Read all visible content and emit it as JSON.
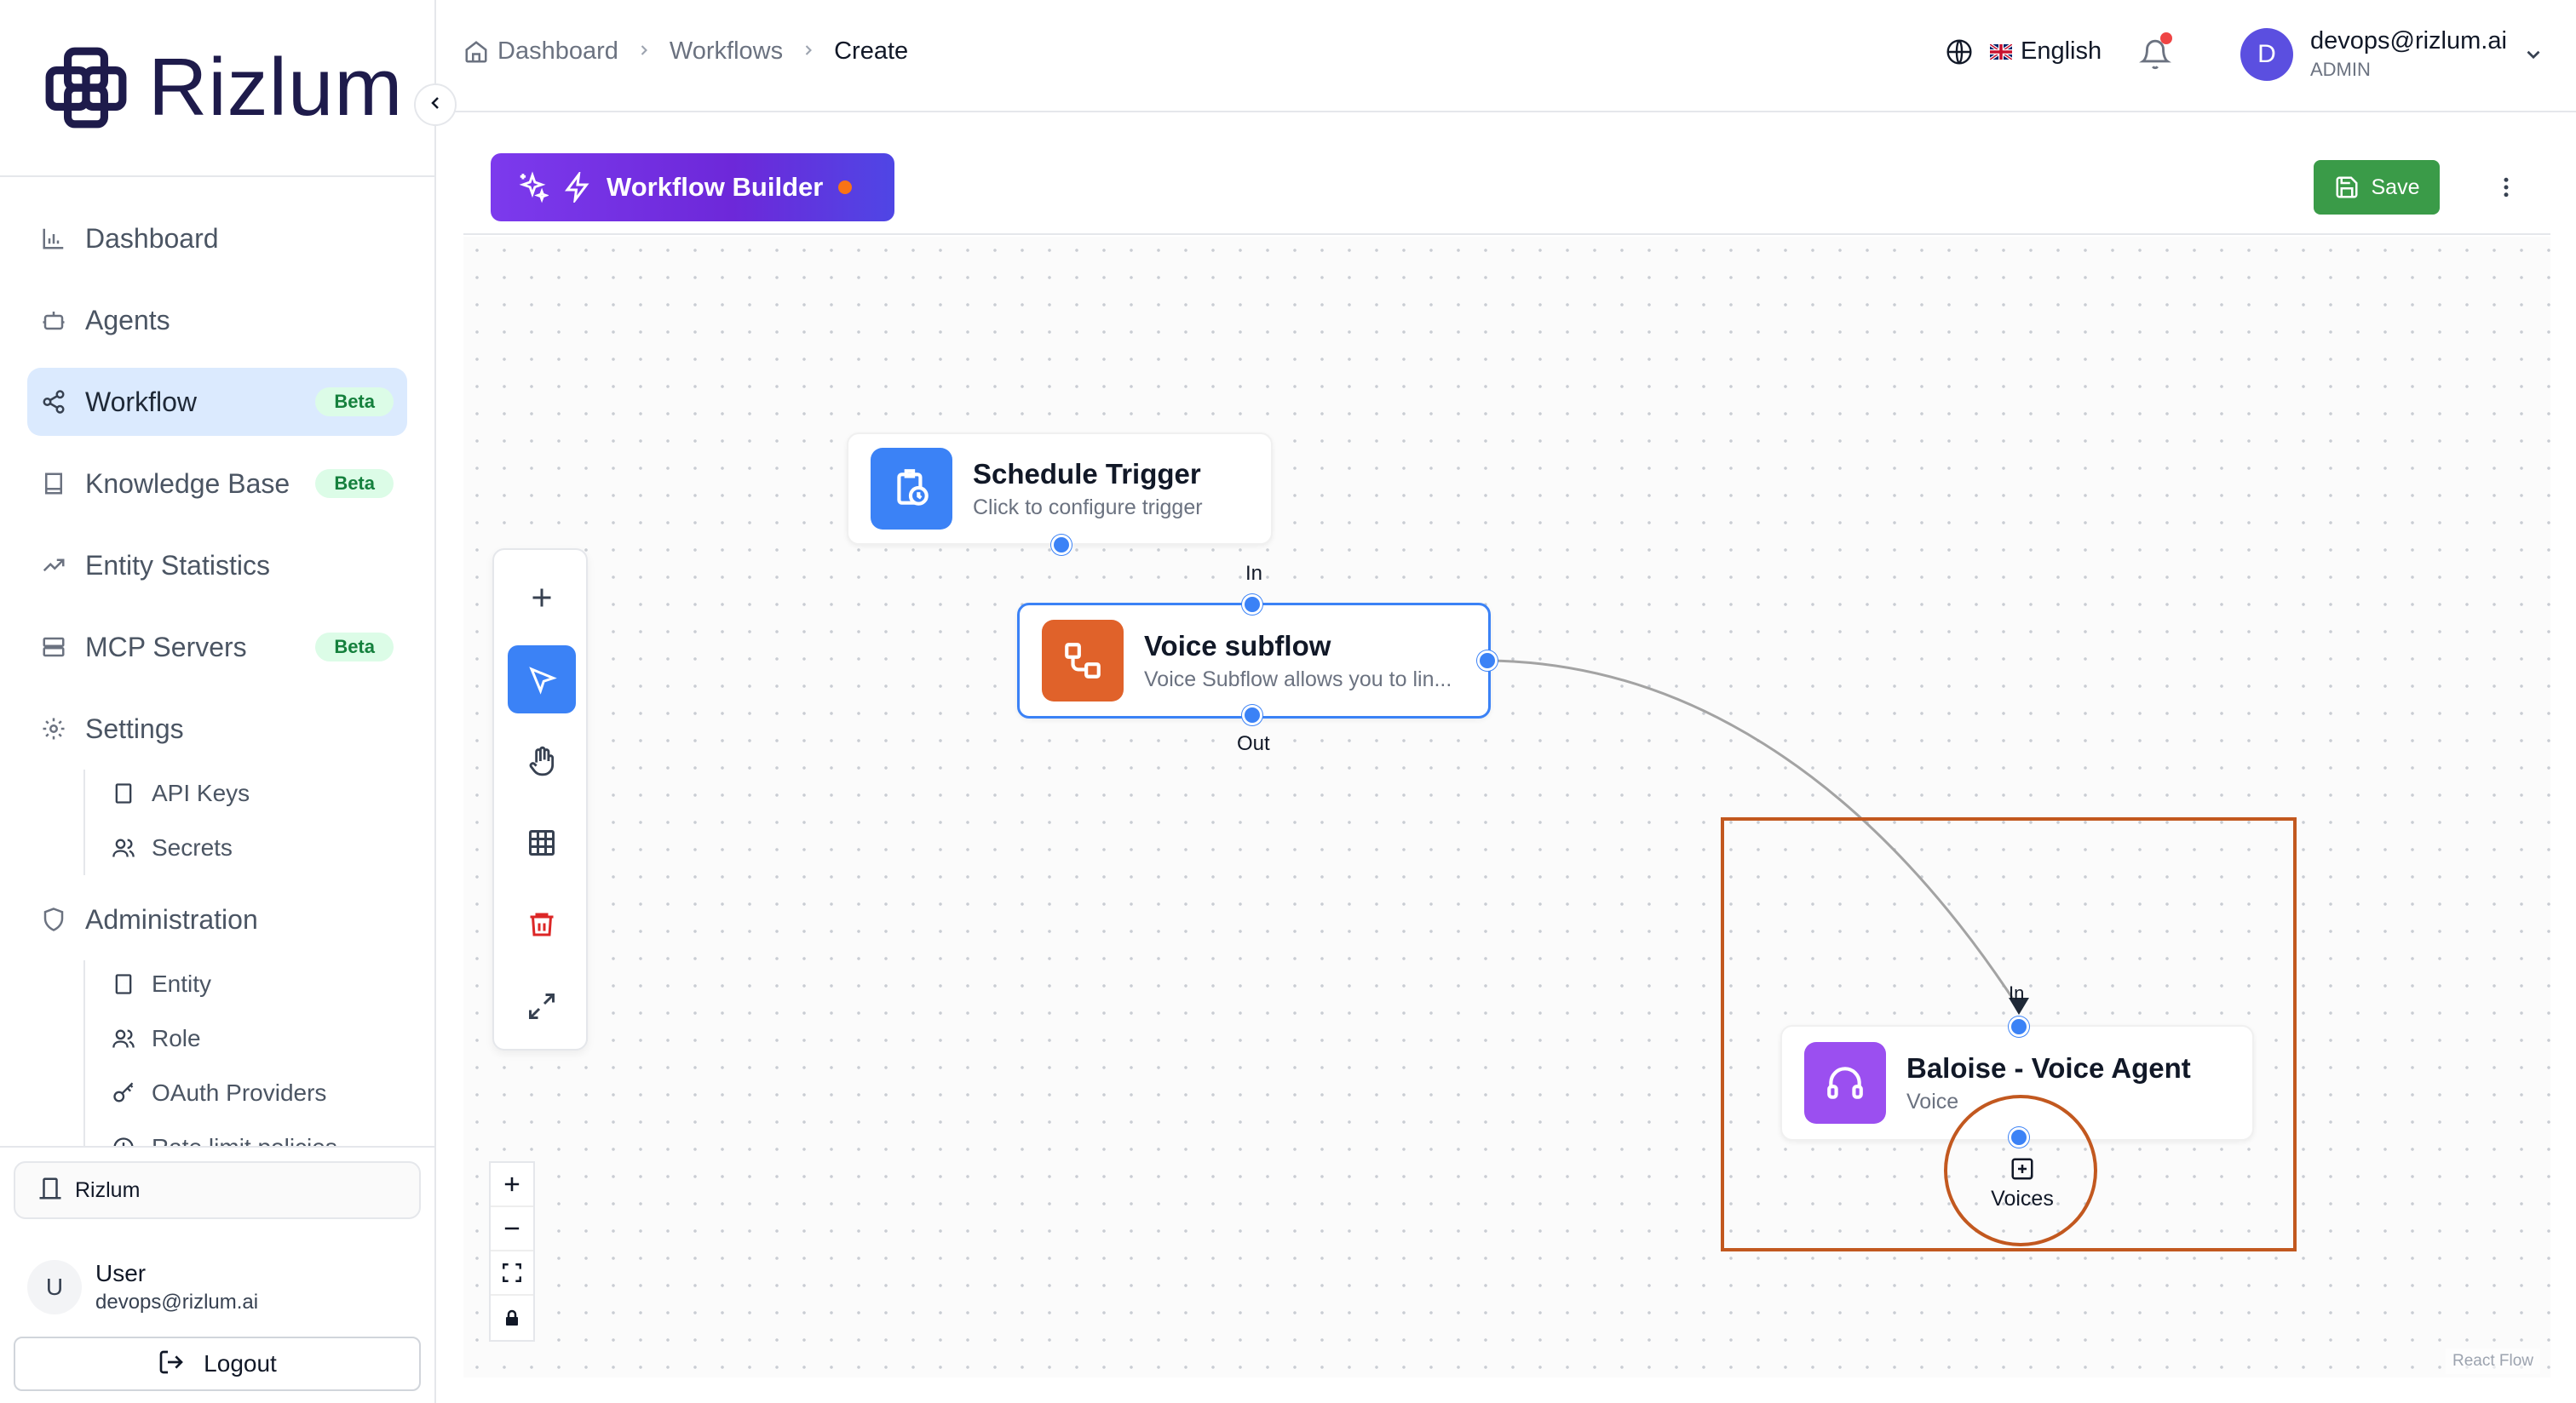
{
  "brand": {
    "name": "Rizlum"
  },
  "sidebar": {
    "items": [
      {
        "label": "Dashboard",
        "badge": ""
      },
      {
        "label": "Agents",
        "badge": ""
      },
      {
        "label": "Workflow",
        "badge": "Beta"
      },
      {
        "label": "Knowledge Base",
        "badge": "Beta"
      },
      {
        "label": "Entity Statistics",
        "badge": ""
      },
      {
        "label": "MCP Servers",
        "badge": "Beta"
      },
      {
        "label": "Settings",
        "badge": ""
      }
    ],
    "settings_sub": [
      {
        "label": "API Keys"
      },
      {
        "label": "Secrets"
      }
    ],
    "administration": {
      "label": "Administration"
    },
    "admin_sub": [
      {
        "label": "Entity"
      },
      {
        "label": "Role"
      },
      {
        "label": "OAuth Providers"
      },
      {
        "label": "Rate limit policies"
      }
    ],
    "org": {
      "label": "Rizlum"
    },
    "user": {
      "initial": "U",
      "name": "User",
      "email": "devops@rizlum.ai"
    },
    "logout": {
      "label": "Logout"
    }
  },
  "header": {
    "breadcrumb": [
      "Dashboard",
      "Workflows",
      "Create"
    ],
    "language": "English",
    "profile": {
      "initial": "D",
      "email": "devops@rizlum.ai",
      "role": "ADMIN"
    }
  },
  "builder": {
    "title": "Workflow Builder",
    "save_label": "Save"
  },
  "canvas": {
    "nodes": {
      "schedule": {
        "title": "Schedule Trigger",
        "subtitle": "Click to configure trigger"
      },
      "subflow": {
        "title": "Voice subflow",
        "subtitle": "Voice Subflow allows you to lin...",
        "in_label": "In",
        "out_label": "Out"
      },
      "agent": {
        "title": "Baloise - Voice Agent",
        "subtitle": "Voice",
        "in_label": "In",
        "voices_label": "Voices"
      }
    },
    "attribution": "React Flow"
  },
  "colors": {
    "accent": "#3b82f6",
    "builder_gradient_start": "#7c3aed",
    "save_green": "#3a9b48",
    "subflow_icon": "#e0622a",
    "agent_icon": "#9b4ff0",
    "highlight": "#c2581f"
  },
  "icons": {
    "sidebar": [
      "chart-icon",
      "robot-icon",
      "share-icon",
      "book-icon",
      "trend-icon",
      "server-icon",
      "gear-icon"
    ],
    "tools": [
      "plus-icon",
      "pointer-icon",
      "hand-icon",
      "grid-icon",
      "trash-icon",
      "expand-icon"
    ]
  }
}
